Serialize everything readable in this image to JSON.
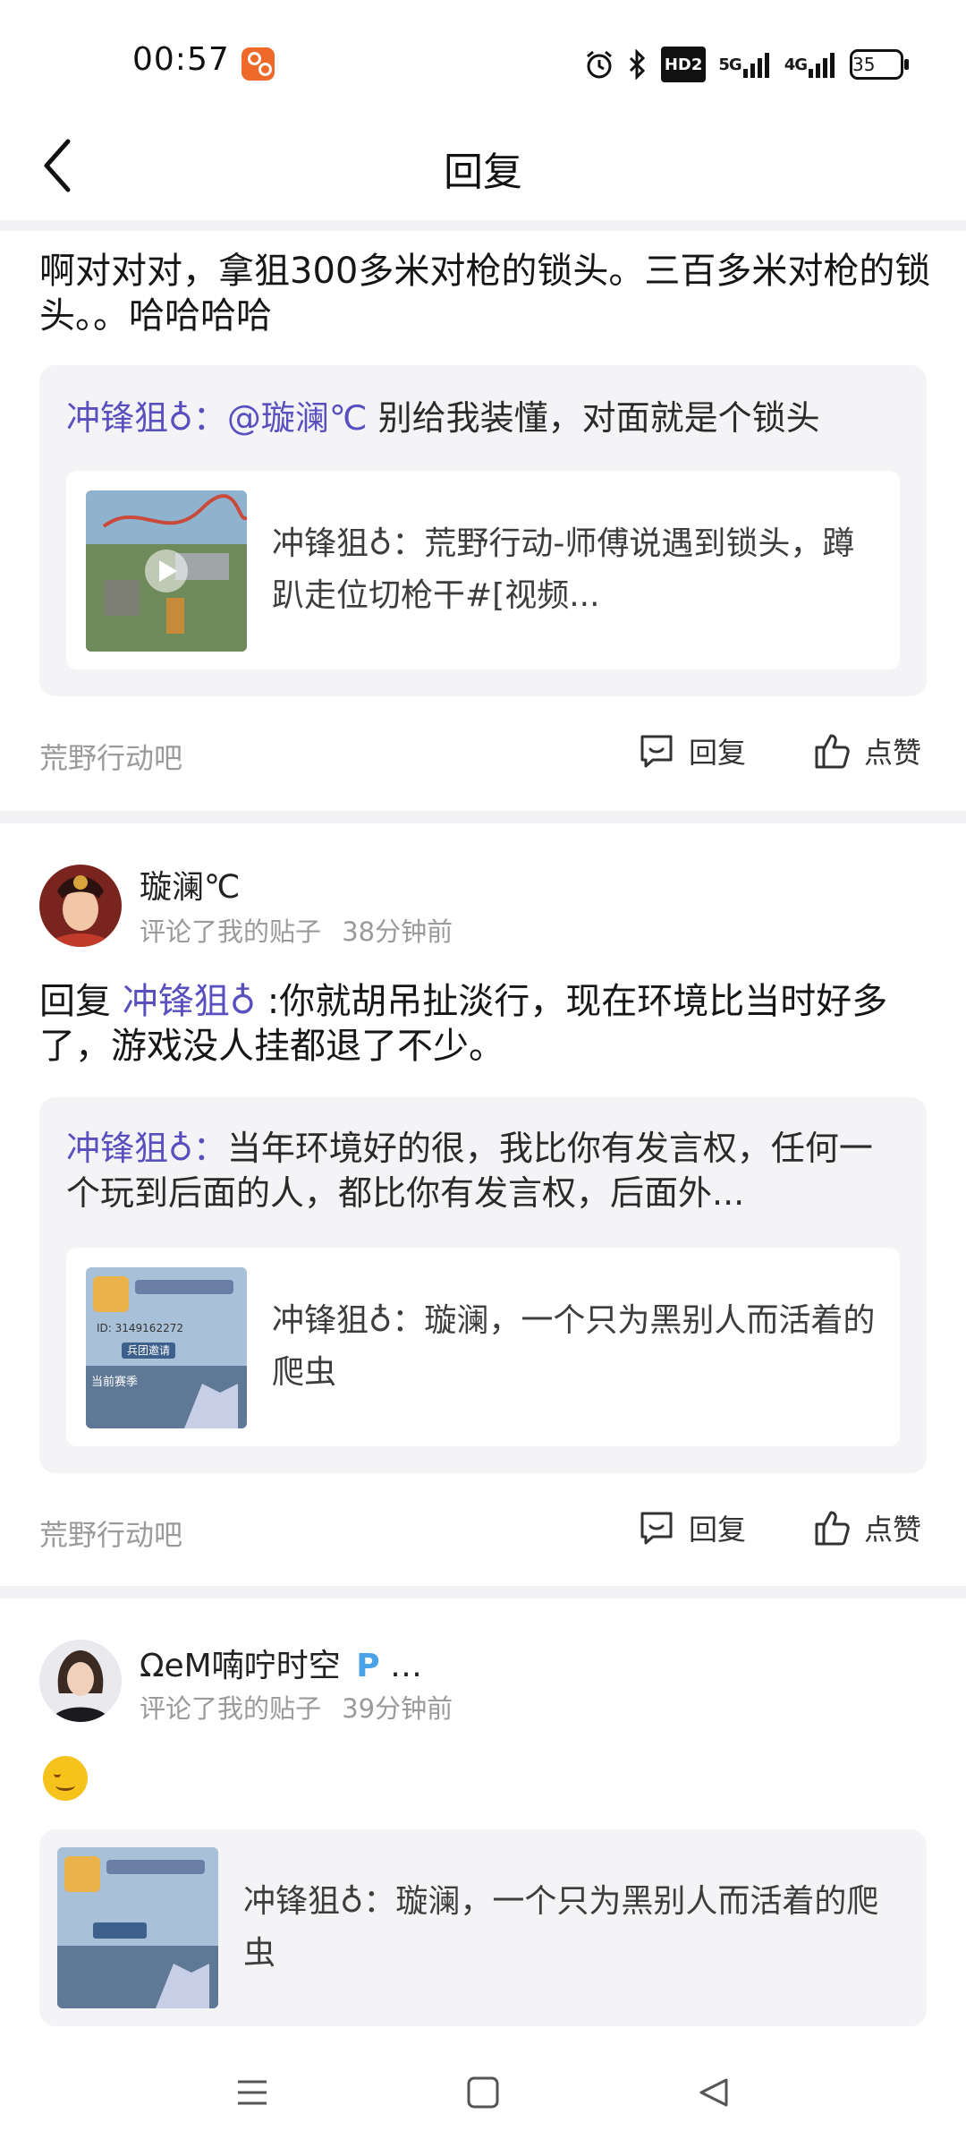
{
  "status_bar": {
    "time": "00:57",
    "app_icon": "gallery-app-icon",
    "icons": [
      "alarm-icon",
      "bluetooth-icon",
      "hd-voice-icon",
      "5g-signal-icon",
      "4g-signal-icon"
    ],
    "hd_label": "HD2",
    "sig1": "5G",
    "sig2": "4G",
    "battery": "35"
  },
  "header": {
    "title": "回复",
    "back_icon": "back-chevron-icon"
  },
  "posts": [
    {
      "text": "啊对对对，拿狙300多米对枪的锁头。三百多米对枪的锁头。。哈哈哈哈",
      "quote": {
        "author": "冲锋狙♁",
        "sep": "：",
        "mention": "@璇澜℃",
        "body": " 别给我装懂，对面就是个锁头"
      },
      "card": {
        "author": "冲锋狙♁",
        "sep": "：",
        "text": "荒野行动-师傅说遇到锁头，蹲趴走位切枪干#[视频..."
      },
      "forum": "荒野行动吧",
      "reply_label": "回复",
      "like_label": "点赞"
    },
    {
      "user": "璇澜℃",
      "meta": "评论了我的贴子",
      "time": "38分钟前",
      "reply_prefix": "回复 ",
      "reply_to": "冲锋狙♁",
      "text": " :你就胡吊扯淡行，现在环境比当时好多了，游戏没人挂都退了不少。",
      "quote": {
        "author": "冲锋狙♁",
        "sep": "：",
        "body": "当年环境好的很，我比你有发言权，任何一个玩到后面的人，都比你有发言权，后面外..."
      },
      "card": {
        "author": "冲锋狙♁",
        "sep": "：",
        "text": "璇澜，一个只为黑别人而活着的爬虫"
      },
      "forum": "荒野行动吧",
      "reply_label": "回复",
      "like_label": "点赞"
    },
    {
      "user": "ΩeM喃咛时空",
      "user_suffix": "…",
      "meta": "评论了我的贴子",
      "time": "39分钟前",
      "emoji": "smile-emoji",
      "card": {
        "author": "冲锋狙♁",
        "sep": "：",
        "text": "璇澜，一个只为黑别人而活着的爬虫"
      }
    }
  ],
  "thumb_text": {
    "id": "ID: 3149162272",
    "badge": "兵团邀请",
    "season": "当前赛季"
  },
  "nav": [
    "menu-icon",
    "home-square-icon",
    "back-triangle-icon"
  ],
  "colors": {
    "accent": "#5a4fbf",
    "muted": "#9a9a9a",
    "quote_bg": "#f4f4f6",
    "divider": "#f2f2f4"
  }
}
